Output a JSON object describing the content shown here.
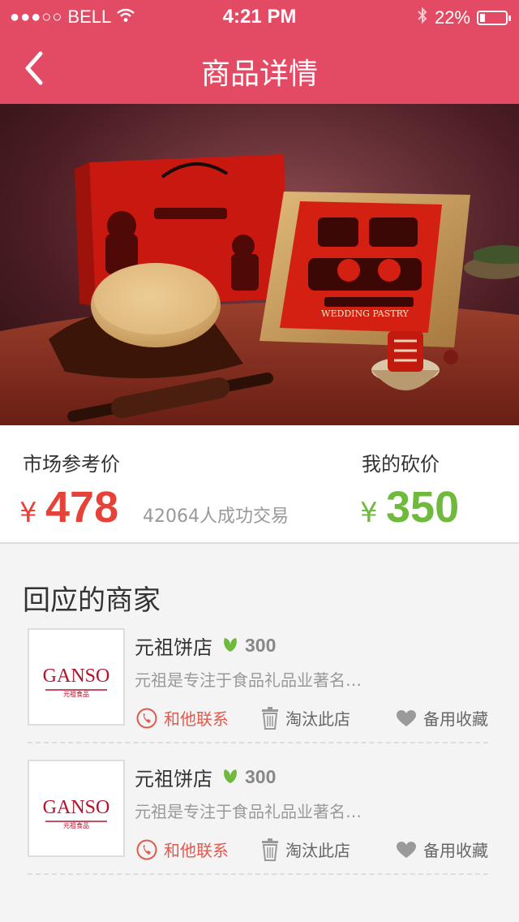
{
  "status_bar": {
    "carrier": "BELL",
    "time": "4:21 PM",
    "battery": "22%",
    "battery_level": 0.22,
    "signal_dots": "●●●○○"
  },
  "nav": {
    "title": "商品详情"
  },
  "price": {
    "market_label": "市场参考价",
    "currency": "¥",
    "market_price": "478",
    "deals_text": "42064人成功交易",
    "my_label": "我的砍价",
    "my_price": "350"
  },
  "section": {
    "title": "回应的商家"
  },
  "merchants": [
    {
      "name": "元祖饼店",
      "score": "300",
      "desc": "元祖是专注于食品礼品业著名…",
      "logo_text": "GANSO",
      "logo_sub": "元祖食品",
      "contact": "和他联系",
      "remove": "淘汰此店",
      "favorite": "备用收藏"
    },
    {
      "name": "元祖饼店",
      "score": "300",
      "desc": "元祖是专注于食品礼品业著名…",
      "logo_text": "GANSO",
      "logo_sub": "元祖食品",
      "contact": "和他联系",
      "remove": "淘汰此店",
      "favorite": "备用收藏"
    }
  ],
  "colors": {
    "brand": "#e34b65",
    "price_red": "#e5433a",
    "price_green": "#6fba3c",
    "action_red": "#e2594e",
    "muted": "#999999"
  },
  "product_image_labels": {
    "package_label": "WEDDING PASTRY"
  }
}
